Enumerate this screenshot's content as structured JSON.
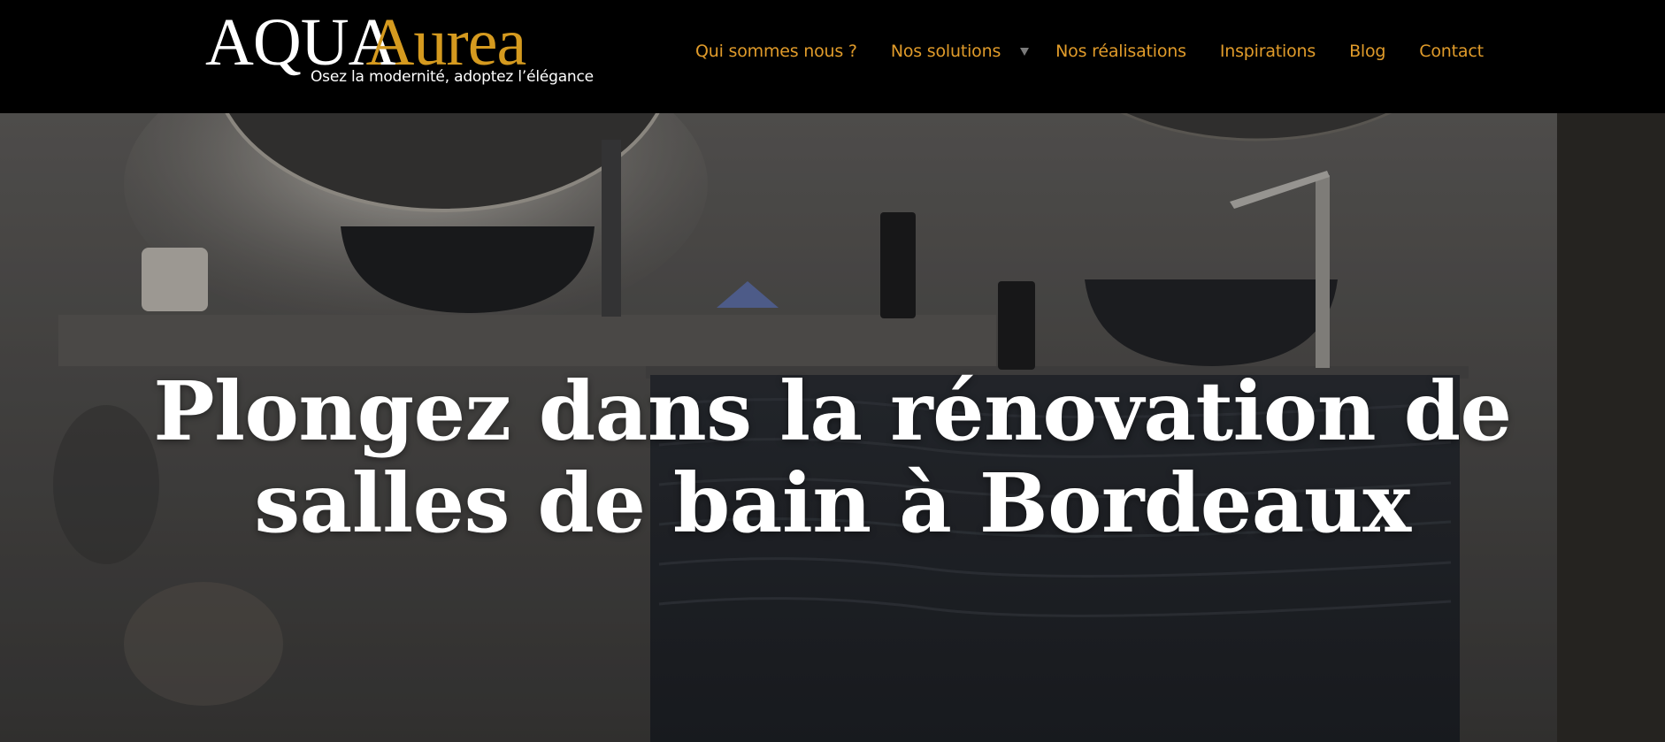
{
  "brand": {
    "name_part1": "AQUA",
    "name_part2": "Aurea",
    "tagline": "Osez la modernité, adoptez l’élégance",
    "accent_color": "#d59a1f"
  },
  "nav": {
    "items": [
      {
        "label": "Qui sommes nous ?"
      },
      {
        "label": "Nos solutions",
        "has_dropdown": true
      },
      {
        "label": "Nos réalisations"
      },
      {
        "label": "Inspirations"
      },
      {
        "label": "Blog"
      },
      {
        "label": "Contact"
      }
    ],
    "link_color": "#e09b2a",
    "dropdown_icon": "caret-down-icon"
  },
  "hero": {
    "title_line1": "Plongez dans la rénovation de",
    "title_line2": "salles de bain à Bordeaux",
    "background": "bathroom-vanity-photo"
  }
}
